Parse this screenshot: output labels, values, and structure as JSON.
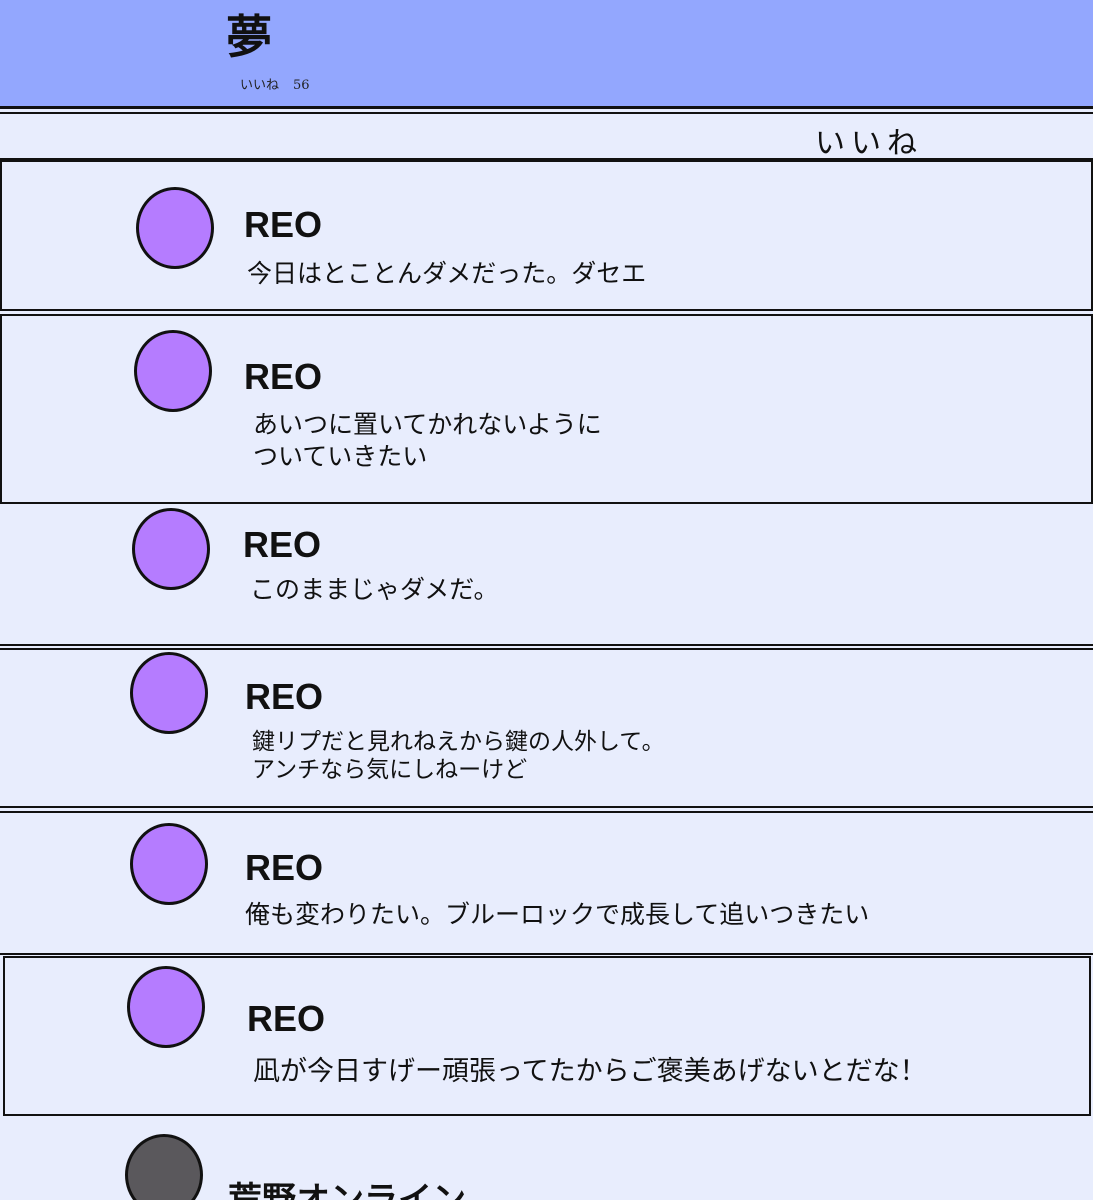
{
  "header": {
    "title": "夢",
    "likes_label": "いいね",
    "likes_count": "56"
  },
  "tabs": {
    "likes_tab": "いいね"
  },
  "colors": {
    "header_bg": "#93a7fe",
    "page_bg": "#e8edfd",
    "avatar_purple": "#b57cff",
    "avatar_gray": "#5a585c"
  },
  "posts": [
    {
      "name": "REO",
      "text": "今日はとことんダメだった。ダセエ"
    },
    {
      "name": "REO",
      "text": "あいつに置いてかれないように\nついていきたい"
    },
    {
      "name": "REO",
      "text": "このままじゃダメだ。"
    },
    {
      "name": "REO",
      "text": "鍵リプだと見れねえから鍵の人外して。\nアンチなら気にしねーけど"
    },
    {
      "name": "REO",
      "text": "俺も変わりたい。ブルーロックで成長して追いつきたい"
    },
    {
      "name": "REO",
      "text": "凪が今日すげー頑張ってたからご褒美あげないとだな！"
    },
    {
      "name": "荒野オンライン",
      "text": ""
    }
  ]
}
